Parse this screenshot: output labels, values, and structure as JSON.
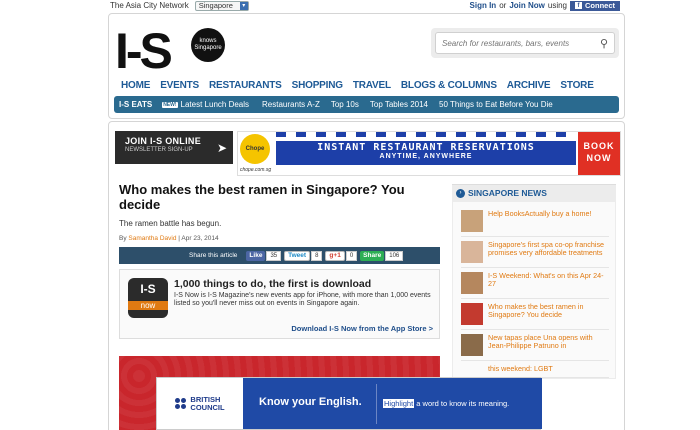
{
  "topbar": {
    "network_label": "The Asia City Network",
    "city_selected": "Singapore",
    "sign_in": "Sign In",
    "or": "or",
    "join_now": "Join Now",
    "using": "using",
    "connect": "Connect"
  },
  "header": {
    "logo_text": "I-S",
    "logo_badge": "knows Singapore",
    "search_placeholder": "Search for restaurants, bars, events"
  },
  "main_nav": [
    "HOME",
    "EVENTS",
    "RESTAURANTS",
    "SHOPPING",
    "TRAVEL",
    "BLOGS & COLUMNS",
    "ARCHIVE",
    "STORE"
  ],
  "sub_nav": {
    "first": "I-S EATS",
    "new_badge": "NEW!",
    "items": [
      "Latest Lunch Deals",
      "Restaurants A-Z",
      "Top 10s",
      "Top Tables 2014",
      "50 Things to Eat Before You Die"
    ]
  },
  "join": {
    "title": "JOIN I-S ONLINE",
    "subtitle": "NEWSLETTER SIGN-UP"
  },
  "ad_chope": {
    "brand": "Chope",
    "url": "chope.com.sg",
    "line1": "INSTANT RESTAURANT RESERVATIONS",
    "line2": "ANYTIME, ANYWHERE",
    "cta1": "BOOK",
    "cta2": "NOW"
  },
  "article": {
    "title": "Who makes the best ramen in Singapore? You decide",
    "dek": "The ramen battle has begun.",
    "by": "By",
    "author": "Samantha David",
    "date": "| Apr 23, 2014"
  },
  "share": {
    "label": "Share this article",
    "fb_label": "Like",
    "fb_count": "35",
    "tw_label": "Tweet",
    "tw_count": "8",
    "gp_label": "g+1",
    "gp_count": "0",
    "share_label": "Share",
    "share_count": "106"
  },
  "promo": {
    "app_top": "I-S",
    "app_bottom": "now",
    "title": "1,000 things to do, the first is download",
    "desc": "I-S Now is I-S Magazine's new events app for iPhone, with more than 1,000 events listed so you'll never miss out on events in Singapore again.",
    "link": "Download I-S Now from the App Store >"
  },
  "sidebar": {
    "title": "SINGAPORE NEWS",
    "items": [
      {
        "text": "Help BooksActually buy a home!",
        "color": "#c8a27a"
      },
      {
        "text": "Singapore's first spa co-op franchise promises very affordable treatments",
        "color": "#d9b59a"
      },
      {
        "text": "I-S Weekend: What's on this Apr 24-27",
        "color": "#b5875e"
      },
      {
        "text": "Who makes the best ramen in Singapore? You decide",
        "color": "#c33a2f"
      },
      {
        "text": "New tapas place Una opens with Jean-Philippe Patruno in",
        "color": "#8a6b4a"
      }
    ],
    "peek_text": "this weekend: LGBT"
  },
  "overlay": {
    "brand_line1": "BRITISH",
    "brand_line2": "COUNCIL",
    "tagline": "Know your English.",
    "highlight": "Highlight",
    "rest": "a word to know its meaning."
  }
}
